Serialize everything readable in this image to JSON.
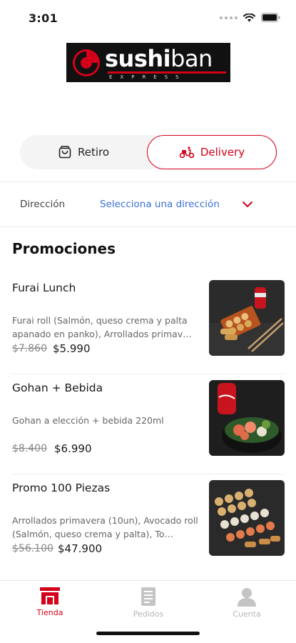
{
  "status_bar": {
    "time": "3:01"
  },
  "brand": {
    "name_bold": "sushi",
    "name_regular": "ban",
    "tagline": "EXPRESS",
    "accent": "#d4001a"
  },
  "mode_toggle": {
    "pickup_label": "Retiro",
    "delivery_label": "Delivery",
    "selected": "delivery"
  },
  "address": {
    "label": "Dirección",
    "value": "Selecciona una dirección"
  },
  "promotions": {
    "title": "Promociones",
    "items": [
      {
        "name": "Furai Lunch",
        "description": "Furai roll (Salmón, queso crema y palta apanado en panko), Arrollados primav…",
        "old_price": "$7.860",
        "price": "$5.990",
        "image": "sushi-platter-with-soda"
      },
      {
        "name": "Gohan + Bebida",
        "description": "Gohan a elección + bebida 220ml",
        "old_price": "$8.400",
        "price": "$6.990",
        "image": "poke-bowl-with-coca-cola"
      },
      {
        "name": "Promo 100 Piezas",
        "description": "Arrollados primavera (10un), Avocado roll (Salmón, queso crema y palta), To…",
        "old_price": "$56.100",
        "price": "$47.900",
        "image": "large-sushi-assortment"
      }
    ]
  },
  "bottom_nav": {
    "items": [
      {
        "label": "Tienda",
        "icon": "store-icon",
        "active": true
      },
      {
        "label": "Pedidos",
        "icon": "receipt-icon",
        "active": false
      },
      {
        "label": "Cuenta",
        "icon": "person-icon",
        "active": false
      }
    ]
  }
}
